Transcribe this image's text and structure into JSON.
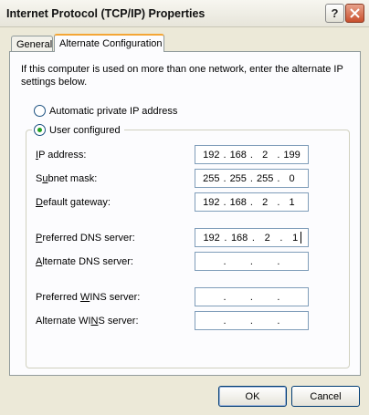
{
  "window": {
    "title": "Internet Protocol (TCP/IP) Properties",
    "help_glyph": "?",
    "close_glyph": "✕"
  },
  "tabs": [
    {
      "label": "General",
      "active": false
    },
    {
      "label": "Alternate Configuration",
      "active": true
    }
  ],
  "description": "If this computer is used on more than one network, enter the alternate IP settings below.",
  "options": {
    "automatic": {
      "label": "Automatic private IP address",
      "selected": false
    },
    "user": {
      "label": "User configured",
      "selected": true
    }
  },
  "fields": [
    {
      "prefix": "I",
      "rest": "P address:",
      "octets": [
        "192",
        "168",
        "2",
        "199"
      ]
    },
    {
      "prefix": "S",
      "rest": "ubnet mask:",
      "pre": "S",
      "octets": [
        "255",
        "255",
        "255",
        "0"
      ]
    },
    {
      "prefix": "D",
      "rest": "efault gateway:",
      "octets": [
        "192",
        "168",
        "2",
        "1"
      ]
    },
    {
      "prefix": "P",
      "rest": "referred DNS server:",
      "octets": [
        "192",
        "168",
        "2",
        "1"
      ]
    },
    {
      "prefix": "A",
      "rest": "lternate DNS server:",
      "octets": [
        "",
        "",
        "",
        ""
      ]
    },
    {
      "label_a": "Preferred ",
      "prefix": "W",
      "label_b": "INS server:",
      "octets": [
        "",
        "",
        "",
        ""
      ]
    },
    {
      "label_a": "Alternate WI",
      "prefix": "N",
      "label_b": "S server:",
      "octets": [
        "",
        "",
        "",
        ""
      ]
    }
  ],
  "buttons": {
    "ok": "OK",
    "cancel": "Cancel"
  },
  "colors": {
    "accent_tab": "#f4a636",
    "radio_selected": "#21a121",
    "dialog_bg": "#ece9d8"
  }
}
